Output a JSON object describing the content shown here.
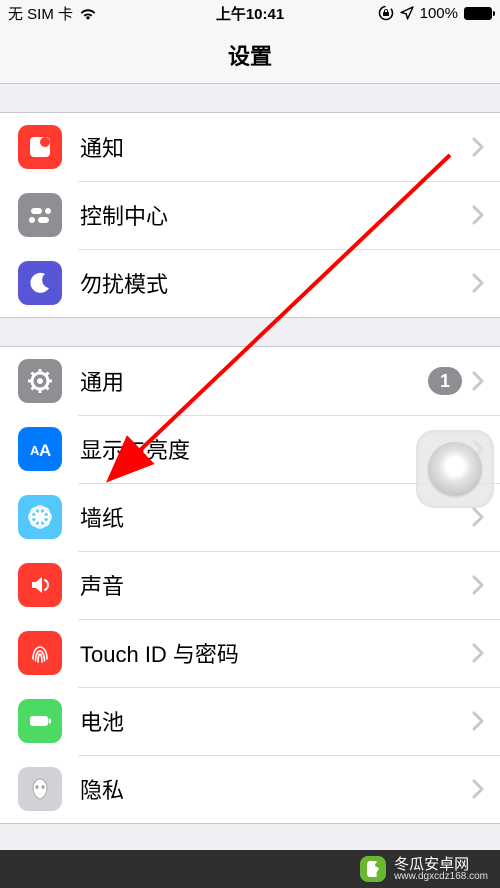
{
  "status": {
    "carrier": "无 SIM 卡",
    "time": "上午10:41",
    "battery_pct": "100%"
  },
  "nav": {
    "title": "设置"
  },
  "group1": {
    "notifications": "通知",
    "control_center": "控制中心",
    "dnd": "勿扰模式"
  },
  "group2": {
    "general": "通用",
    "general_badge": "1",
    "display": "显示与亮度",
    "wallpaper": "墙纸",
    "sounds": "声音",
    "touchid": "Touch ID 与密码",
    "battery": "电池",
    "privacy": "隐私"
  },
  "watermark": {
    "text": "冬瓜安卓网",
    "url": "www.dgxcdz168.com"
  }
}
